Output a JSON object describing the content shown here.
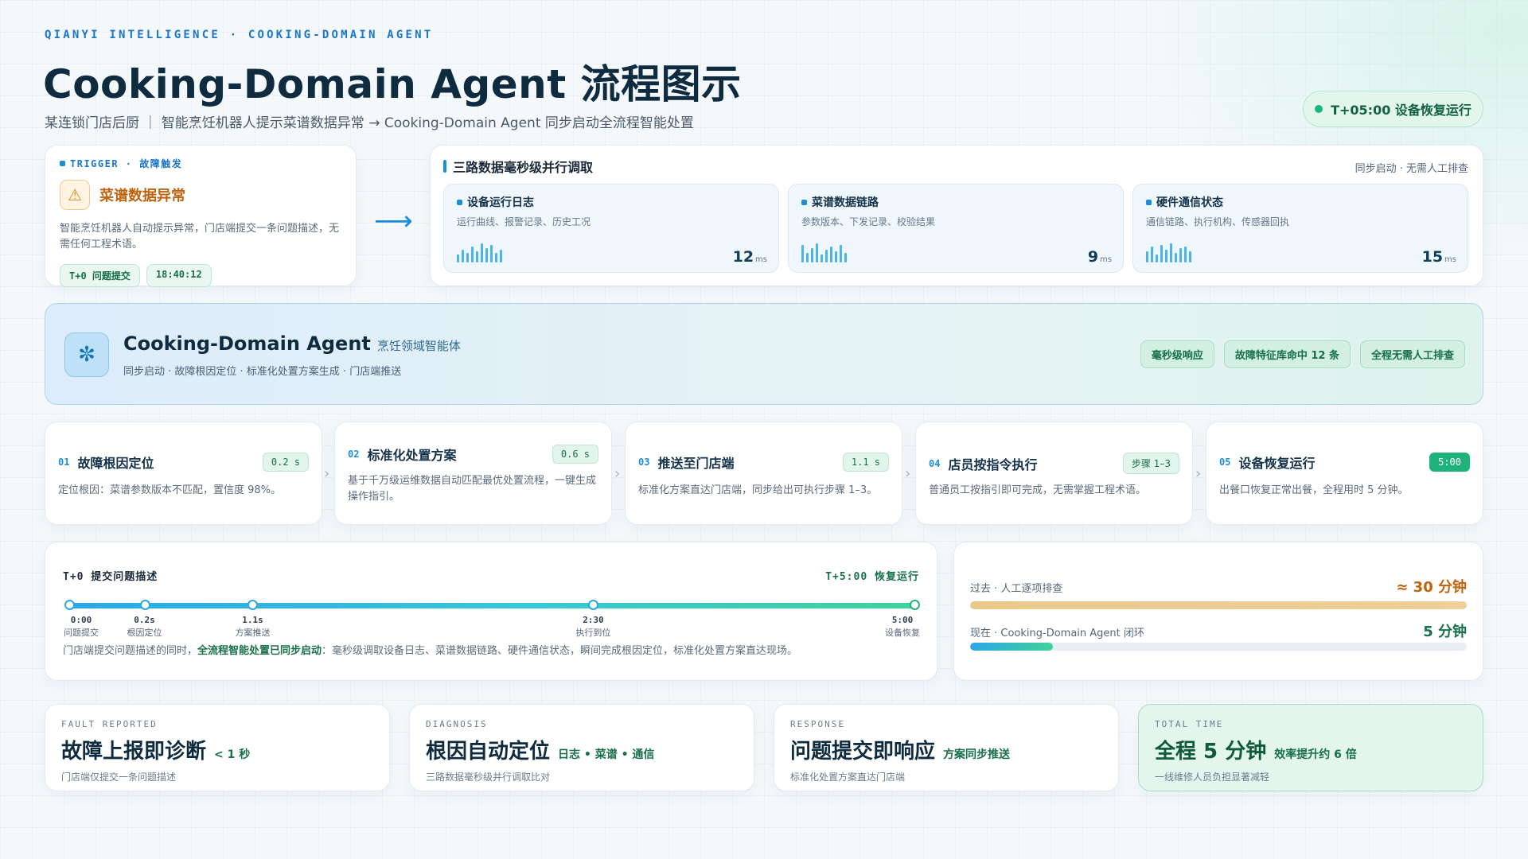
{
  "header": {
    "eyebrow": "QIANYI INTELLIGENCE · COOKING-DOMAIN AGENT",
    "title": "Cooking-Domain Agent 流程图示",
    "subtitle": "某连锁门店后厨 ｜ 智能烹饪机器人提示菜谱数据异常 → Cooking-Domain Agent 同步启动全流程智能处置",
    "status": "T+05:00 设备恢复运行"
  },
  "trigger": {
    "tag": "TRIGGER · 故障触发",
    "title": "菜谱数据异常",
    "desc": "智能烹饪机器人自动提示异常，门店端提交一条问题描述，无需任何工程术语。",
    "chip1": "T+0 问题提交",
    "chip2": "18:40:12"
  },
  "lanes": {
    "title": "三路数据毫秒级并行调取",
    "note": "同步启动 · 无需人工排查",
    "items": [
      {
        "title": "设备运行日志",
        "sub": "运行曲线、报警记录、历史工况",
        "ms": "12",
        "unit": "ms"
      },
      {
        "title": "菜谱数据链路",
        "sub": "参数版本、下发记录、校验结果",
        "ms": "9",
        "unit": "ms"
      },
      {
        "title": "硬件通信状态",
        "sub": "通信链路、执行机构、传感器回执",
        "ms": "15",
        "unit": "ms"
      }
    ]
  },
  "agent": {
    "title": "Cooking-Domain Agent",
    "subtitle": "烹饪领域智能体",
    "desc": "同步启动 · 故障根因定位 · 标准化处置方案生成 · 门店端推送",
    "tags": [
      "毫秒级响应",
      "故障特征库命中 12 条",
      "全程无需人工排查"
    ]
  },
  "steps": [
    {
      "num": "01",
      "title": "故障根因定位",
      "badge": "0.2 s",
      "desc": "定位根因：菜谱参数版本不匹配，置信度 98%。"
    },
    {
      "num": "02",
      "title": "标准化处置方案",
      "badge": "0.6 s",
      "desc": "基于千万级运维数据自动匹配最优处置流程，一键生成操作指引。"
    },
    {
      "num": "03",
      "title": "推送至门店端",
      "badge": "1.1 s",
      "desc": "标准化方案直达门店端，同步给出可执行步骤 1–3。"
    },
    {
      "num": "04",
      "title": "店员按指令执行",
      "badge": "步骤 1–3",
      "desc": "普通员工按指引即可完成，无需掌握工程术语。"
    },
    {
      "num": "05",
      "title": "设备恢复运行",
      "badge": "5:00",
      "desc": "出餐口恢复正常出餐，全程用时 5 分钟。"
    }
  ],
  "timeline": {
    "left": "T+0  提交问题描述",
    "right": "T+5:00 恢复运行",
    "nodes": [
      {
        "t": "0:00",
        "d": "问题提交",
        "pos": 0
      },
      {
        "t": "0.2s",
        "d": "根因定位",
        "pos": 0.089
      },
      {
        "t": "1.1s",
        "d": "方案推送",
        "pos": 0.217
      },
      {
        "t": "2:30",
        "d": "执行到位",
        "pos": 0.62
      },
      {
        "t": "5:00",
        "d": "设备恢复",
        "pos": 1
      }
    ],
    "desc_pre": "门店端提交问题描述的同时，",
    "desc_bold": "全流程智能处置已同步启动",
    "desc_post": "：毫秒级调取设备日志、菜谱数据链路、硬件通信状态，瞬间完成根因定位，标准化处置方案直达现场。"
  },
  "compare": {
    "past_label": "过去 · 人工逐项排查",
    "past_value": "≈ 30 分钟",
    "past_fraction": 1.0,
    "now_label": "现在 · Cooking-Domain Agent 闭环",
    "now_value": "5 分钟",
    "now_fraction": 0.167
  },
  "summary": [
    {
      "k": "FAULT REPORTED",
      "h": "故障上报即诊断",
      "aux": "< 1 秒",
      "s": "门店端仅提交一条问题描述"
    },
    {
      "k": "DIAGNOSIS",
      "h": "根因自动定位",
      "aux": "日志 • 菜谱 • 通信",
      "s": "三路数据毫秒级并行调取比对"
    },
    {
      "k": "RESPONSE",
      "h": "问题提交即响应",
      "aux": "方案同步推送",
      "s": "标准化处置方案直达门店端"
    },
    {
      "k": "TOTAL TIME",
      "h": "全程 5 分钟",
      "aux": "效率提升约 6 倍",
      "s": "一线维修人员负担显著减轻"
    }
  ]
}
